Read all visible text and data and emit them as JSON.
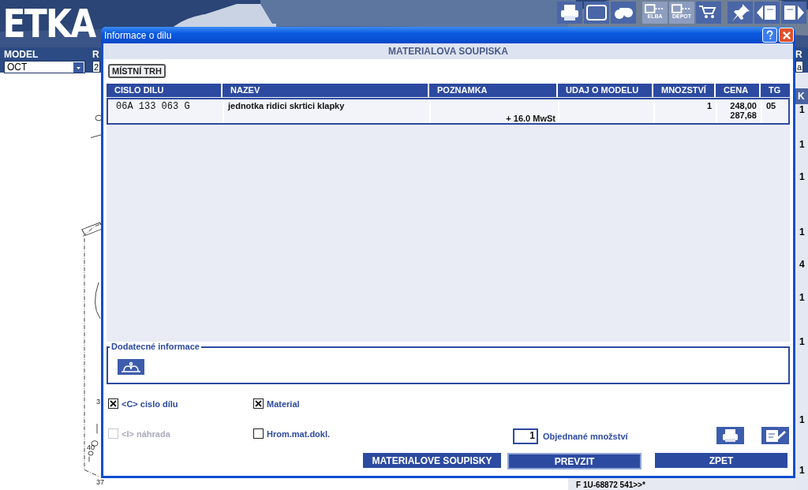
{
  "app": {
    "logo": "ETKA",
    "toolbar": [
      {
        "kind": "printer"
      },
      {
        "kind": "frame"
      },
      {
        "kind": "binoculars"
      },
      {
        "kind": "monitor",
        "label": "ELBA"
      },
      {
        "kind": "monitor",
        "label": "DEPOT"
      },
      {
        "kind": "carts"
      },
      {
        "kind": "pin"
      },
      {
        "kind": "page-back"
      },
      {
        "kind": "page-forward"
      }
    ],
    "filters": [
      {
        "label": "MODEL",
        "value": "OCT",
        "kind": "dropdown"
      },
      {
        "label": "R",
        "value": "2",
        "kind": "text"
      }
    ],
    "right_filter": {
      "label": "R",
      "value": "a"
    },
    "diagram_labels": [
      "3",
      "40",
      "37"
    ],
    "side_column": {
      "header": "K",
      "values": [
        "1",
        "1",
        "1",
        "1",
        "4",
        "1",
        "1",
        "1",
        "1"
      ]
    },
    "bottom_text": "F 1U-68872 541>>*"
  },
  "dialog": {
    "title": "Informace o dilu",
    "heading": "MATERIALOVA SOUPISKA",
    "market_button": "MÍSTNÍ TRH",
    "table": {
      "columns": [
        "CISLO DILU",
        "NAZEV",
        "POZNAMKA",
        "UDAJ O MODELU",
        "MNOZSTVÍ",
        "CENA",
        "TG"
      ],
      "rows": [
        {
          "selected": true,
          "part_number": "06A 133 063 G",
          "name": "jednotka ridici skrtici klapky",
          "note": "+ 16.0 MwSt",
          "quantity": "1",
          "price": "248,00",
          "price_gross": "287,68",
          "tg": "05"
        }
      ]
    },
    "extra_info": {
      "legend": "Dodatecné informace"
    },
    "options": [
      {
        "label": "<C> cislo dílu",
        "checked": true,
        "disabled": false
      },
      {
        "label": "Material",
        "checked": true,
        "disabled": false
      },
      {
        "label": "<I> náhrada",
        "checked": false,
        "disabled": true
      },
      {
        "label": "Hrom.mat.dokl.",
        "checked": false,
        "disabled": false
      }
    ],
    "quantity": {
      "value": "1",
      "label": "Objednané množství"
    },
    "buttons": [
      {
        "label": "MATERIALOVE SOUPISKY",
        "default": false
      },
      {
        "label": "PREVZIT",
        "default": true
      },
      {
        "label": "ZPET",
        "default": false
      }
    ]
  }
}
